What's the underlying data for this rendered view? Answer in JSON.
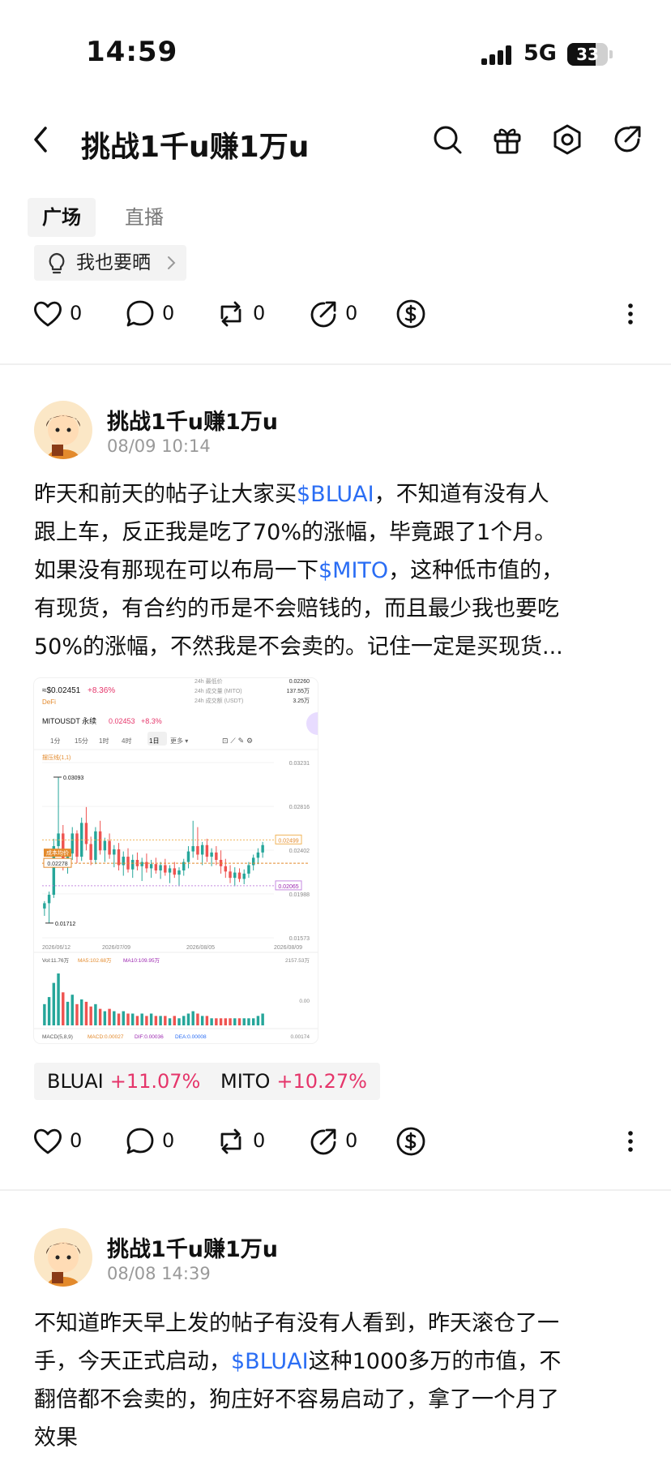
{
  "status_bar": {
    "time": "14:59",
    "network": "5G",
    "battery": "33"
  },
  "nav": {
    "title": "挑战1千u赚1万u"
  },
  "tabs": [
    {
      "label": "广场"
    },
    {
      "label": "直播"
    }
  ],
  "share_chip": {
    "label": "我也要晒"
  },
  "actions_top": {
    "like": "0",
    "comment": "0",
    "repost": "0",
    "share": "0"
  },
  "posts": [
    {
      "author": "挑战1千u赚1万u",
      "time": "08/09 10:14",
      "lines": [
        [
          "昨天和前天的帖子让大家买",
          "$BLUAI",
          "，不知道有没有人"
        ],
        [
          "跟上车，反正我是吃了70%的涨幅，毕竟跟了1个月。"
        ],
        [
          "如果没有那现在可以布局一下",
          "$MITO",
          "，这种低市值的，"
        ],
        [
          "有现货，有合约的币是不会赔钱的，而且最少我也要吃"
        ],
        [
          "50%的涨幅，不然我是不会卖的。记住一定是买现货..."
        ]
      ],
      "tickers": [
        {
          "symbol": "BLUAI",
          "change": "+11.07%"
        },
        {
          "symbol": "MITO",
          "change": "+10.27%"
        }
      ],
      "actions": {
        "like": "0",
        "comment": "0",
        "repost": "0",
        "share": "0"
      }
    },
    {
      "author": "挑战1千u赚1万u",
      "time": "08/08 14:39",
      "lines": [
        [
          "不知道昨天早上发的帖子有没有人看到，昨天滚仓了一"
        ],
        [
          "手，今天正式启动，",
          "$BLUAI",
          "这种1000多万的市值，不"
        ],
        [
          "翻倍都不会卖的，狗庄好不容易启动了，拿了一个月了"
        ],
        [
          "效果"
        ]
      ]
    }
  ],
  "chart_data": {
    "type": "candlestick",
    "title": "MITOUSDT 永续",
    "price": "0.02453",
    "change": "+8.3%",
    "header_price": "≈$0.02451",
    "header_change": "+8.36%",
    "header_tag": "DeFi",
    "stats": [
      {
        "label": "24h 最低价",
        "value": "0.02260"
      },
      {
        "label": "24h 成交量 (MITO)",
        "value": "137.55万"
      },
      {
        "label": "24h 成交额 (USDT)",
        "value": "3.25万"
      }
    ],
    "intervals": [
      "1分",
      "15分",
      "1时",
      "4时",
      "1日",
      "更多"
    ],
    "active_interval": "1日",
    "indicator_label": "摆压线(1,1)",
    "ylim": [
      0.01573,
      0.03231
    ],
    "y_ticks": [
      "0.03231",
      "0.02816",
      "0.02402",
      "0.01988",
      "0.01573"
    ],
    "x_ticks": [
      "2026/06/12",
      "2026/07/09",
      "2026/08/05",
      "2026/08/09"
    ],
    "annotations": {
      "high": "0.03093",
      "low": "0.01712",
      "cost": "0.02278",
      "cost_label": "成本均价",
      "line_top": "0.02499",
      "line_bottom": "0.02065"
    },
    "candles": [
      [
        0.0185,
        0.0192,
        0.0178,
        0.019
      ],
      [
        0.019,
        0.0201,
        0.0171,
        0.0198
      ],
      [
        0.0198,
        0.0251,
        0.0195,
        0.0244
      ],
      [
        0.0244,
        0.0309,
        0.0238,
        0.0256
      ],
      [
        0.0256,
        0.0264,
        0.0221,
        0.0229
      ],
      [
        0.0229,
        0.0241,
        0.0218,
        0.0237
      ],
      [
        0.0237,
        0.0262,
        0.0231,
        0.0256
      ],
      [
        0.0256,
        0.0259,
        0.0228,
        0.0234
      ],
      [
        0.0234,
        0.0271,
        0.023,
        0.0266
      ],
      [
        0.0266,
        0.0281,
        0.024,
        0.0246
      ],
      [
        0.0246,
        0.0253,
        0.0226,
        0.0231
      ],
      [
        0.0231,
        0.0262,
        0.0227,
        0.0258
      ],
      [
        0.0258,
        0.0268,
        0.0236,
        0.024
      ],
      [
        0.024,
        0.0252,
        0.0229,
        0.0249
      ],
      [
        0.0249,
        0.0256,
        0.0232,
        0.0236
      ],
      [
        0.0236,
        0.0245,
        0.0224,
        0.0241
      ],
      [
        0.0241,
        0.0247,
        0.0221,
        0.0226
      ],
      [
        0.0226,
        0.0239,
        0.0216,
        0.0234
      ],
      [
        0.0234,
        0.0242,
        0.0219,
        0.0222
      ],
      [
        0.0222,
        0.0236,
        0.0214,
        0.0231
      ],
      [
        0.0231,
        0.0238,
        0.0221,
        0.0225
      ],
      [
        0.0225,
        0.0233,
        0.0211,
        0.0229
      ],
      [
        0.0229,
        0.0237,
        0.0219,
        0.0223
      ],
      [
        0.0223,
        0.0231,
        0.0214,
        0.0227
      ],
      [
        0.0227,
        0.0233,
        0.0218,
        0.0221
      ],
      [
        0.0221,
        0.0229,
        0.0213,
        0.0226
      ],
      [
        0.0226,
        0.0232,
        0.0216,
        0.0219
      ],
      [
        0.0219,
        0.0226,
        0.0209,
        0.0223
      ],
      [
        0.0223,
        0.0229,
        0.0214,
        0.0217
      ],
      [
        0.0217,
        0.0224,
        0.0206,
        0.0221
      ],
      [
        0.0221,
        0.0232,
        0.0216,
        0.0229
      ],
      [
        0.0229,
        0.0244,
        0.0223,
        0.0239
      ],
      [
        0.0239,
        0.0268,
        0.0233,
        0.0244
      ],
      [
        0.0244,
        0.0262,
        0.0231,
        0.0236
      ],
      [
        0.0236,
        0.0248,
        0.0226,
        0.0245
      ],
      [
        0.0245,
        0.0251,
        0.0229,
        0.0234
      ],
      [
        0.0234,
        0.0242,
        0.0225,
        0.0238
      ],
      [
        0.0238,
        0.0244,
        0.0226,
        0.0231
      ],
      [
        0.0231,
        0.024,
        0.0218,
        0.0225
      ],
      [
        0.0225,
        0.0232,
        0.0214,
        0.022
      ],
      [
        0.022,
        0.0226,
        0.0209,
        0.0214
      ],
      [
        0.0214,
        0.0224,
        0.0206,
        0.0219
      ],
      [
        0.0219,
        0.0223,
        0.021,
        0.0213
      ],
      [
        0.0213,
        0.0222,
        0.0208,
        0.0218
      ],
      [
        0.0218,
        0.0229,
        0.0214,
        0.0226
      ],
      [
        0.0226,
        0.0236,
        0.0221,
        0.0233
      ],
      [
        0.0233,
        0.0242,
        0.0227,
        0.0238
      ],
      [
        0.0238,
        0.0248,
        0.0233,
        0.0245
      ]
    ],
    "volume_label": "Vol:11.76万",
    "ma5_label": "MA5:102.68万",
    "ma10_label": "MA10:109.95万",
    "volume_ticks": [
      "2157.53万",
      "0.00"
    ],
    "volumes": [
      9,
      12,
      18,
      22,
      14,
      10,
      13,
      9,
      11,
      10,
      8,
      9,
      7,
      6,
      7,
      6,
      5,
      6,
      5,
      5,
      4,
      5,
      4,
      5,
      4,
      4,
      4,
      3,
      4,
      3,
      4,
      5,
      6,
      5,
      4,
      4,
      3,
      3,
      3,
      3,
      3,
      3,
      3,
      3,
      3,
      3,
      4,
      5
    ],
    "macd_label": "MACD(5,8,9)",
    "macd_value": "MACD:0.00027",
    "dif_value": "DIF:0.00036",
    "dea_value": "DEA:0.00008",
    "macd_tick": "0.00174",
    "colors": {
      "up": "#26a69a",
      "down": "#ef5350"
    }
  }
}
